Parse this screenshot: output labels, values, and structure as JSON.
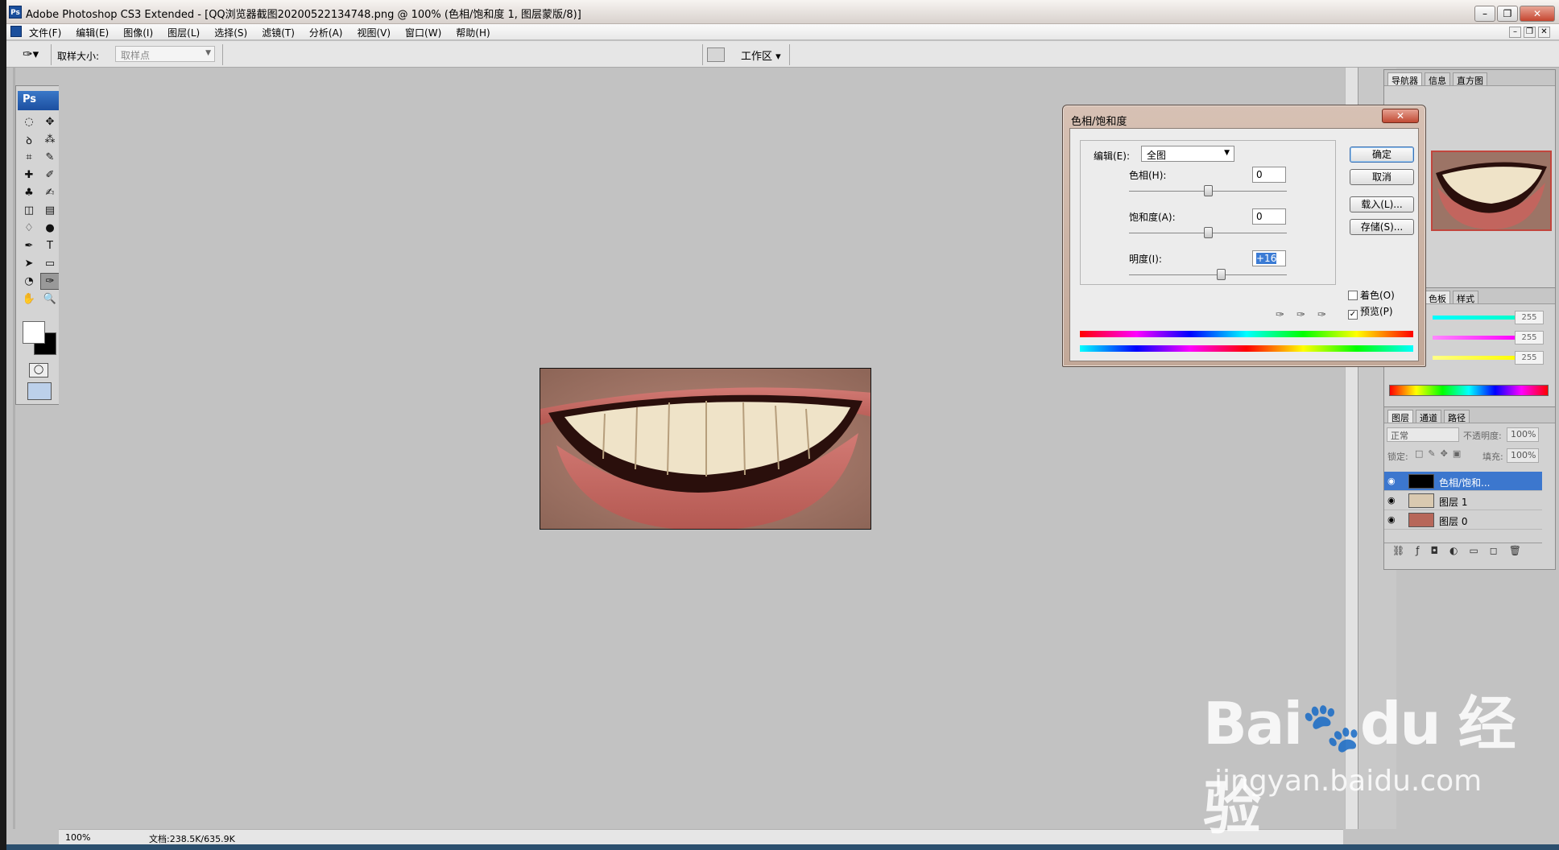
{
  "window": {
    "app_badge": "Ps",
    "title": "Adobe Photoshop CS3 Extended - [QQ浏览器截图20200522134748.png @ 100% (色相/饱和度 1, 图层蒙版/8)]",
    "buttons": {
      "minimize": "–",
      "restore": "❐",
      "close": "✕"
    }
  },
  "menu": {
    "items": [
      "文件(F)",
      "编辑(E)",
      "图像(I)",
      "图层(L)",
      "选择(S)",
      "滤镜(T)",
      "分析(A)",
      "视图(V)",
      "窗口(W)",
      "帮助(H)"
    ]
  },
  "options": {
    "sample_size_label": "取样大小:",
    "sample_size_value": "取样点",
    "workspace_label": "工作区 ▾"
  },
  "tools": {
    "logo": "Ps",
    "icons": [
      "marquee-icon",
      "move-icon",
      "lasso-icon",
      "magic-wand-icon",
      "crop-icon",
      "slice-icon",
      "healing-icon",
      "brush-icon",
      "stamp-icon",
      "history-brush-icon",
      "eraser-icon",
      "gradient-icon",
      "blur-icon",
      "dodge-icon",
      "pen-icon",
      "type-icon",
      "path-select-icon",
      "shape-icon",
      "notes-icon",
      "eyedropper-icon",
      "hand-icon",
      "zoom-icon"
    ],
    "glyphs": [
      "◌",
      "✥",
      "ꝺ",
      "⁂",
      "⌗",
      "✎",
      "✚",
      "✐",
      "♣",
      "✍",
      "◫",
      "▤",
      "♢",
      "●",
      "✒",
      "T",
      "➤",
      "▭",
      "◔",
      "✑",
      "✋",
      "🔍"
    ]
  },
  "status": {
    "zoom": "100%",
    "doc": "文档:238.5K/635.9K"
  },
  "panels": {
    "nav_tabs": [
      "导航器",
      "信息",
      "直方图"
    ],
    "color_tabs": [
      "色板",
      "样式"
    ],
    "color_values": [
      "255",
      "255",
      "255"
    ],
    "layers_tabs": [
      "图层",
      "通道",
      "路径"
    ],
    "blend_mode": "正常",
    "opacity_label": "不透明度:",
    "opacity_value": "100%",
    "lock_label": "锁定:",
    "fill_label": "填充:",
    "fill_value": "100%",
    "layers": [
      {
        "name": "色相/饱和...",
        "selected": true
      },
      {
        "name": "图层 1",
        "selected": false
      },
      {
        "name": "图层 0",
        "selected": false
      }
    ]
  },
  "dialog": {
    "title": "色相/饱和度",
    "close": "✕",
    "edit_label": "编辑(E):",
    "edit_value": "全图",
    "hue_label": "色相(H):",
    "hue_value": "0",
    "sat_label": "饱和度(A):",
    "sat_value": "0",
    "light_label": "明度(I):",
    "light_value": "+16",
    "ok": "确定",
    "cancel": "取消",
    "load": "载入(L)...",
    "save": "存储(S)...",
    "colorize_label": "着色(O)",
    "colorize_checked": false,
    "preview_label": "预览(P)",
    "preview_checked": true
  },
  "watermark": {
    "logo": "Bai du 经验",
    "url": "jingyan.baidu.com"
  }
}
